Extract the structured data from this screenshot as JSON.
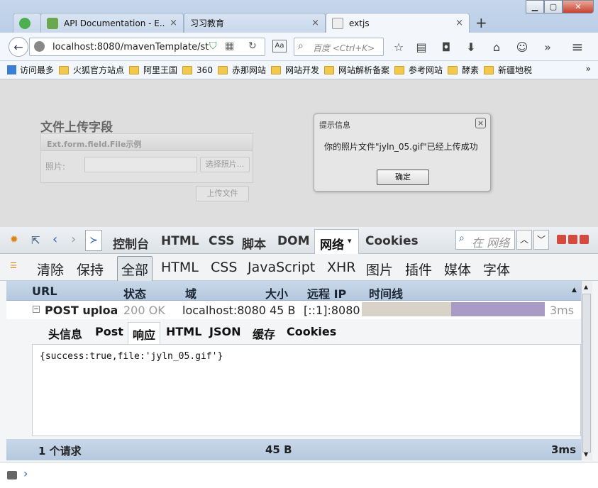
{
  "tabs": [
    {
      "label": "",
      "favicon_color": "#4caf50"
    },
    {
      "label": "API Documentation - E...",
      "favicon_color": "#6aa84f"
    },
    {
      "label": "习习教育",
      "favicon_color": ""
    },
    {
      "label": "extjs",
      "favicon_color": "#e8e8e8"
    }
  ],
  "tab_close_glyph": "×",
  "new_tab_glyph": "+",
  "url": "localhost:8080/mavenTemplate/st",
  "search_placeholder": "百度 <Ctrl+K>",
  "bookmarks": [
    "访问最多",
    "火狐官方站点",
    "阿里王国",
    "360",
    "赤那网站",
    "网站开发",
    "网站解析备案",
    "参考网站",
    "酵素",
    "新疆地税"
  ],
  "bookmarks_more": "»",
  "form": {
    "title": "文件上传字段",
    "panel_title": "Ext.form.field.File示例",
    "photo_label": "照片:",
    "browse_button": "选择照片...",
    "upload_button": "上传文件"
  },
  "dialog": {
    "title": "提示信息",
    "close_glyph": "×",
    "message": "你的照片文件\"jyln_05.gif\"已经上传成功",
    "ok_button": "确定"
  },
  "devtools": {
    "panels": [
      "控制台",
      "HTML",
      "CSS",
      "脚本",
      "DOM",
      "网络",
      "Cookies"
    ],
    "active_panel_arrow": "▾",
    "search_placeholder": "在 网络",
    "filters": [
      "清除",
      "保持",
      "全部",
      "HTML",
      "CSS",
      "JavaScript",
      "XHR",
      "图片",
      "插件",
      "媒体",
      "字体"
    ],
    "columns": [
      "URL",
      "状态",
      "域",
      "大小",
      "远程 IP",
      "时间线"
    ],
    "request": {
      "expander": "−",
      "url": "POST uploa",
      "status": "200 OK",
      "domain": "localhost:8080",
      "size": "45 B",
      "remote_ip": "[::1]:8080",
      "time": "3ms",
      "timeline_waiting_fraction": 0.49,
      "timeline_receiving_fraction": 0.51
    },
    "subtabs": [
      "头信息",
      "Post",
      "响应",
      "HTML",
      "JSON",
      "缓存",
      "Cookies"
    ],
    "response_text": "{success:true,file:'jyln_05.gif'}",
    "footer": {
      "count": "1 个请求",
      "size": "45 B",
      "time": "3ms"
    },
    "cmd_prompt": "›"
  },
  "colors": {
    "timeline_wait": "#d8d2c8",
    "timeline_recv": "#a99ac6",
    "accent": "#2a63b3"
  }
}
